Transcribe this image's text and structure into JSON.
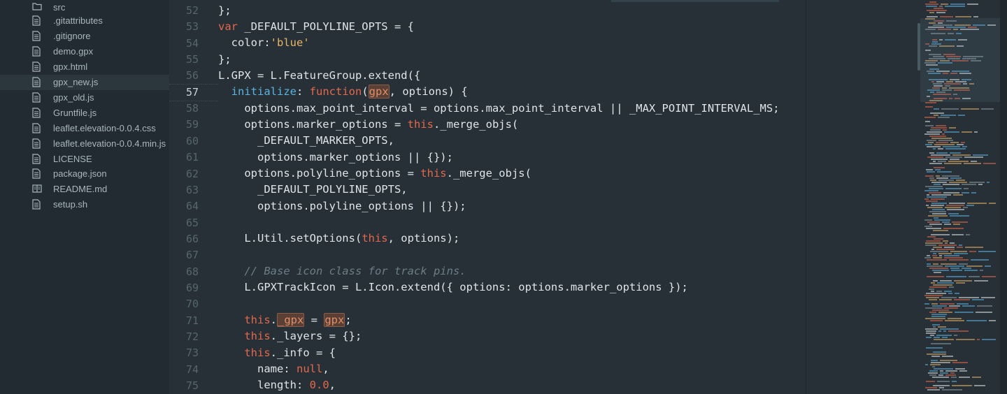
{
  "sidebar": {
    "items": [
      {
        "label": "src",
        "icon": "folder-icon"
      },
      {
        "label": ".gitattributes",
        "icon": "file-icon"
      },
      {
        "label": ".gitignore",
        "icon": "file-icon"
      },
      {
        "label": "demo.gpx",
        "icon": "file-icon"
      },
      {
        "label": "gpx.html",
        "icon": "file-icon"
      },
      {
        "label": "gpx_new.js",
        "icon": "file-icon",
        "active": true
      },
      {
        "label": "gpx_old.js",
        "icon": "file-icon"
      },
      {
        "label": "Gruntfile.js",
        "icon": "file-icon"
      },
      {
        "label": "leaflet.elevation-0.0.4.css",
        "icon": "file-icon"
      },
      {
        "label": "leaflet.elevation-0.0.4.min.js",
        "icon": "file-icon"
      },
      {
        "label": "LICENSE",
        "icon": "file-icon"
      },
      {
        "label": "package.json",
        "icon": "file-icon"
      },
      {
        "label": "README.md",
        "icon": "book-icon"
      },
      {
        "label": "setup.sh",
        "icon": "file-icon"
      }
    ]
  },
  "editor": {
    "current_line": "57",
    "line_numbers": [
      "52",
      "53",
      "54",
      "55",
      "56",
      "57",
      "58",
      "59",
      "60",
      "61",
      "62",
      "63",
      "64",
      "65",
      "66",
      "67",
      "68",
      "69",
      "70",
      "71",
      "72",
      "73",
      "74",
      "75"
    ],
    "lines": {
      "l52": "};",
      "l53_kw": "var",
      "l53_rest": " _DEFAULT_POLYLINE_OPTS = {",
      "l54_a": "  color:",
      "l54_str": "'blue'",
      "l55": "};",
      "l56": "L.GPX = L.FeatureGroup.extend({",
      "l57_fn": "initialize",
      "l57_colon": ": ",
      "l57_kw": "function",
      "l57_open": "(",
      "l57_hl": "gpx",
      "l57_rest": ", options) {",
      "l58": "    options.max_point_interval = options.max_point_interval || _MAX_POINT_INTERVAL_MS;",
      "l59_a": "    options.marker_options = ",
      "l59_kw": "this",
      "l59_b": "._merge_objs(",
      "l60": "      _DEFAULT_MARKER_OPTS,",
      "l61": "      options.marker_options || {});",
      "l62_a": "    options.polyline_options = ",
      "l62_kw": "this",
      "l62_b": "._merge_objs(",
      "l63": "      _DEFAULT_POLYLINE_OPTS,",
      "l64": "      options.polyline_options || {});",
      "l66_a": "    L.Util.setOptions(",
      "l66_kw": "this",
      "l66_b": ", options);",
      "l68": "    // Base icon class for track pins.",
      "l69": "    L.GPXTrackIcon = L.Icon.extend({ options: options.marker_options });",
      "l71_kw": "this",
      "l71_dot": ".",
      "l71_hl1": "_gpx",
      "l71_eq": " = ",
      "l71_hl2": "gpx",
      "l71_end": ";",
      "l72_kw": "this",
      "l72_rest": "._layers = {};",
      "l73_kw": "this",
      "l73_rest": "._info = {",
      "l74_a": "      name: ",
      "l74_kw": "null",
      "l74_end": ",",
      "l75_a": "      length: ",
      "l75_num": "0.0",
      "l75_end": ","
    }
  },
  "colors": {
    "background": "#263036",
    "sidebar": "#212b31",
    "keyword": "#e3684c",
    "function": "#5bb3e1",
    "string": "#e5b567",
    "comment": "#6c7d86"
  }
}
